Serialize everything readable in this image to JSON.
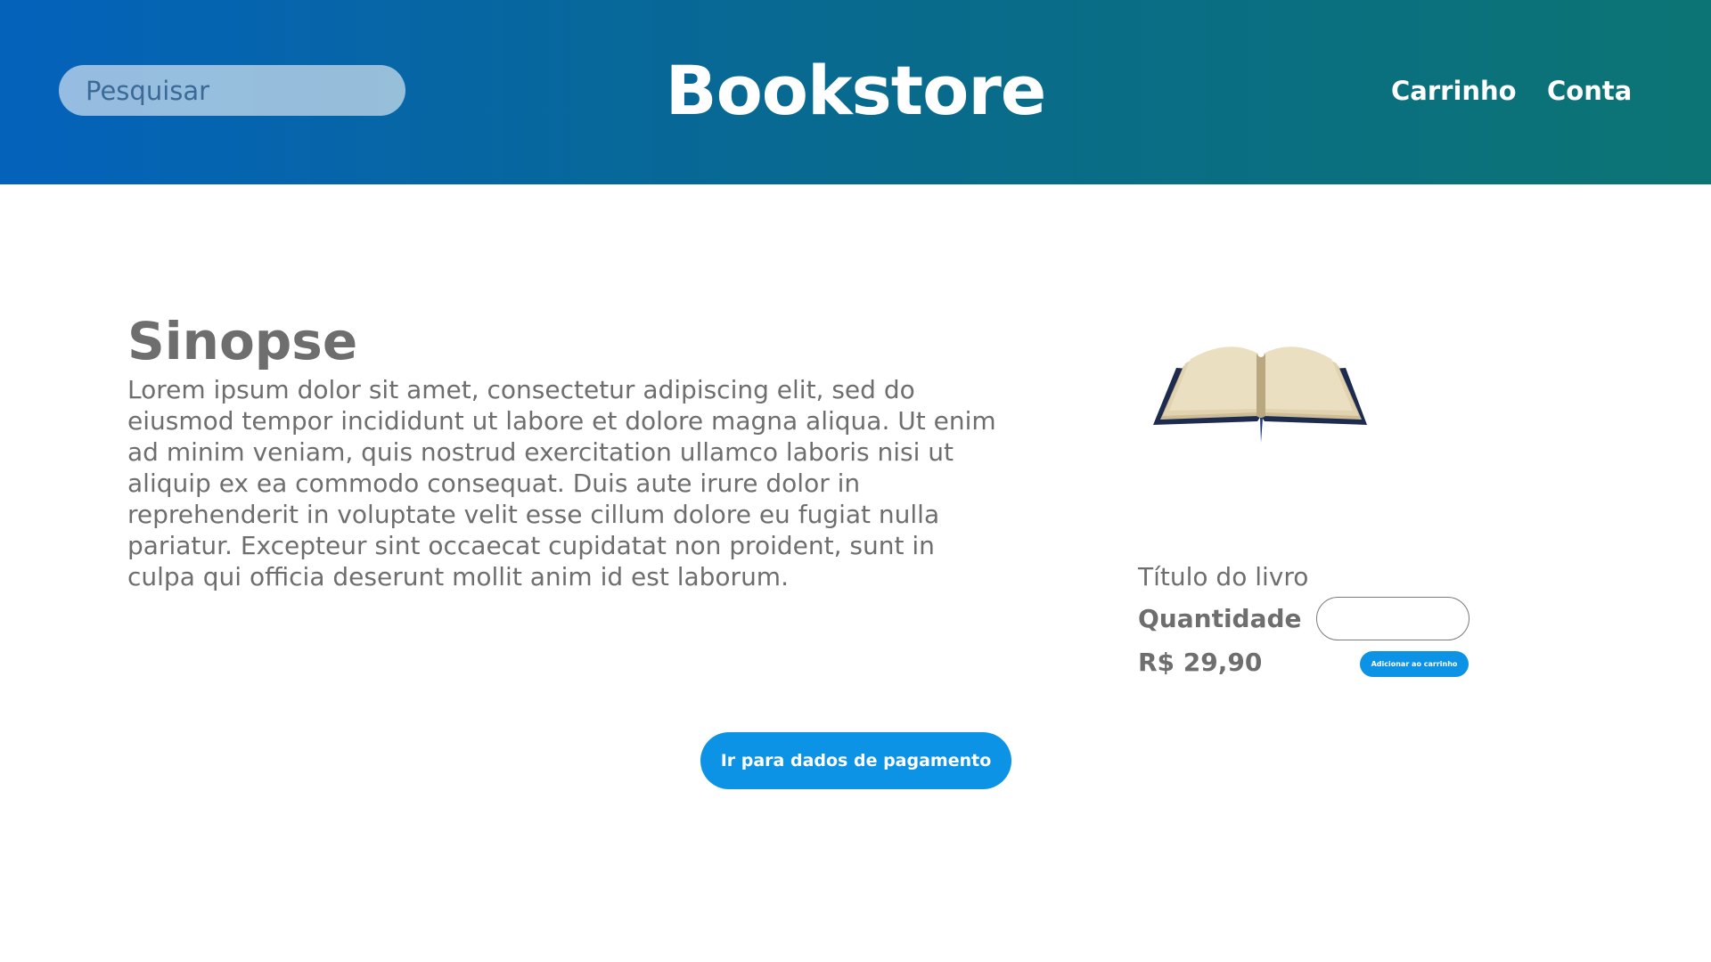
{
  "header": {
    "search_placeholder": "Pesquisar",
    "brand": "Bookstore",
    "nav": {
      "cart": "Carrinho",
      "account": "Conta"
    }
  },
  "synopsis": {
    "title": "Sinopse",
    "text": "Lorem ipsum dolor sit amet, consectetur adipiscing elit, sed do eiusmod tempor incididunt ut labore et dolore magna aliqua. Ut enim ad minim veniam, quis nostrud exercitation ullamco laboris nisi ut aliquip ex ea commodo consequat. Duis aute irure dolor in reprehenderit in voluptate velit esse cillum dolore eu fugiat nulla pariatur. Excepteur sint occaecat cupidatat non proident, sunt in culpa qui officia deserunt mollit anim id est laborum."
  },
  "product": {
    "image_icon": "open-book-icon",
    "title": "Título do livro",
    "quantity_label": "Quantidade",
    "quantity_value": "",
    "price": "R$ 29,90",
    "add_to_cart_label": "Adicionar ao carrinho"
  },
  "checkout": {
    "payment_button_label": "Ir para dados de pagamento"
  },
  "colors": {
    "header_gradient_start": "#0462bb",
    "header_gradient_end": "#0c7474",
    "accent_button": "#0d93e6",
    "text_gray": "#6e6e6e"
  }
}
